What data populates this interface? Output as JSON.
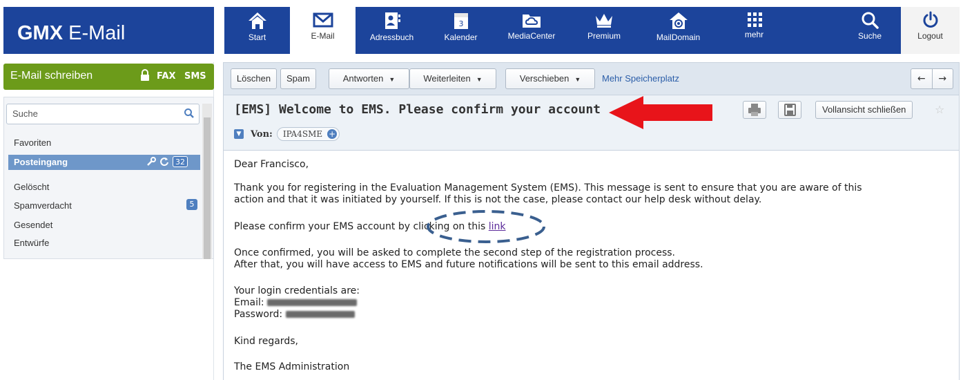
{
  "brand": {
    "bold": "GMX",
    "light": "E-Mail"
  },
  "nav": [
    {
      "icon": "home-icon",
      "label": "Start"
    },
    {
      "icon": "envelope-icon",
      "label": "E-Mail"
    },
    {
      "icon": "contacts-icon",
      "label": "Adressbuch"
    },
    {
      "icon": "calendar-icon",
      "label": "Kalender",
      "day": "3"
    },
    {
      "icon": "cloud-folder-icon",
      "label": "MediaCenter"
    },
    {
      "icon": "crown-icon",
      "label": "Premium"
    },
    {
      "icon": "at-home-icon",
      "label": "MailDomain"
    },
    {
      "icon": "grid-icon",
      "label": "mehr"
    },
    {
      "icon": "search-icon",
      "label": "Suche"
    },
    {
      "icon": "power-icon",
      "label": "Logout"
    }
  ],
  "sidebar": {
    "compose_label": "E-Mail schreiben",
    "fax": "FAX",
    "sms": "SMS",
    "search_placeholder": "Suche",
    "favorites": "Favoriten",
    "inbox_label": "Posteingang",
    "inbox_count": "32",
    "folders": [
      {
        "label": "Gelöscht"
      },
      {
        "label": "Spamverdacht",
        "count": "5"
      },
      {
        "label": "Gesendet"
      },
      {
        "label": "Entwürfe"
      }
    ]
  },
  "toolbar": {
    "delete": "Löschen",
    "spam": "Spam",
    "reply": "Antworten",
    "forward": "Weiterleiten",
    "move": "Verschieben",
    "more_space": "Mehr Speicherplatz",
    "prev": "←",
    "next": "→"
  },
  "message": {
    "subject": "[EMS] Welcome to EMS. Please confirm your account",
    "from_label": "Von:",
    "from_name": "IPA4SME",
    "close_full_view": "Vollansicht schließen",
    "greeting": "Dear Francisco,",
    "para1_line1": "Thank you for registering in the Evaluation Management System (EMS). This message is sent to ensure that you are aware of this",
    "para1_line2": "action and that it was initiated by yourself. If this is not the case, please contact our help desk without delay.",
    "confirm_text": "Please confirm your EMS account by clicking on this ",
    "confirm_link": "link",
    "para3_line1": "Once confirmed, you will be asked to complete the second step of the registration process.",
    "para3_line2": "After that, you will have access to EMS and future notifications will be sent to this email address.",
    "credentials_intro": "Your login credentials are:",
    "email_label": "Email:",
    "password_label": "Password:",
    "regards": "Kind regards,",
    "signature": "The EMS Administration"
  },
  "colors": {
    "header": "#1c449b",
    "compose": "#6c9b1a",
    "inbox_highlight": "#6e97c9",
    "arrow": "#e8141a",
    "circle": "#3a5f8f"
  }
}
